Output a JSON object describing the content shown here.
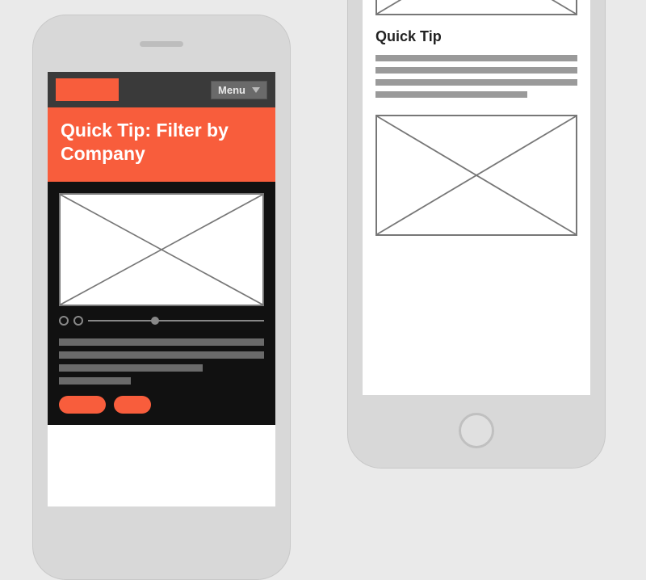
{
  "colors": {
    "accent": "#f85d3c",
    "dark": "#111111",
    "header": "#3a3a3a"
  },
  "left": {
    "menu_label": "Menu",
    "hero_title": "Quick Tip: Filter by Company"
  },
  "right": {
    "section_title": "Quick Tip"
  }
}
